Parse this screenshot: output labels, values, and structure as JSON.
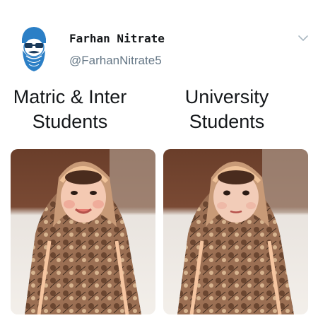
{
  "author": {
    "display_name": "Farhan Nitrate",
    "handle": "@FarhanNitrate5"
  },
  "captions": {
    "left_line1": "Matric & Inter",
    "left_line2": "Students",
    "right_line1": "University",
    "right_line2": "Students"
  },
  "colors": {
    "text_primary": "#14171a",
    "text_secondary": "#657786",
    "avatar_blue": "#2b7fc6",
    "caret_gray": "#aab8c2"
  },
  "icons": {
    "avatar": "avatar-icon",
    "caret": "chevron-down-icon"
  }
}
